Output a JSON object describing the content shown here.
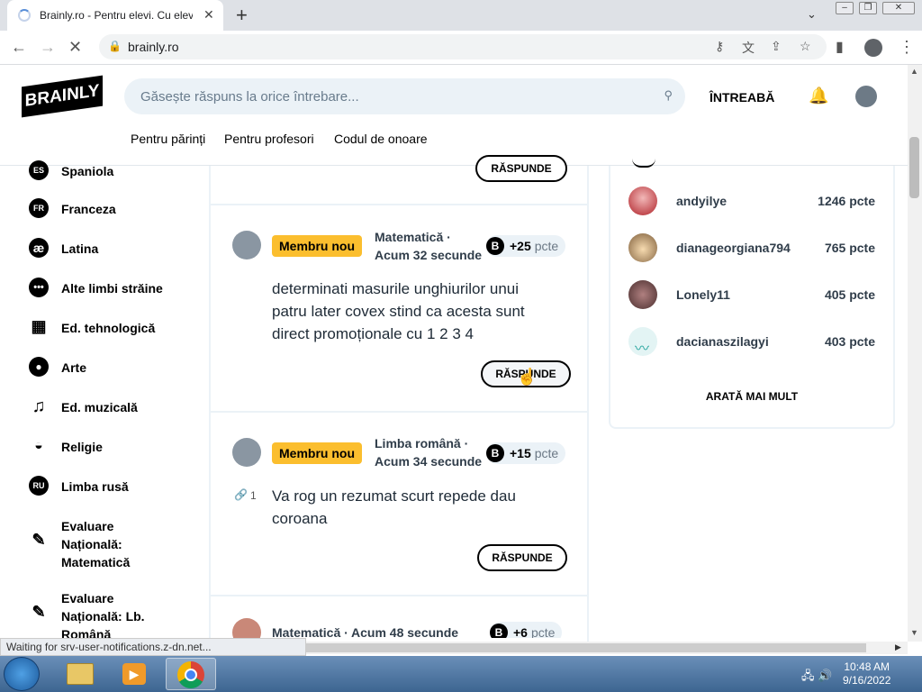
{
  "browser": {
    "tab_title": "Brainly.ro - Pentru elevi. Cu elevi.",
    "tab_close": "✕",
    "new_tab": "+",
    "url": "brainly.ro",
    "status_text": "Waiting for srv-user-notifications.z-dn.net..."
  },
  "header": {
    "logo": "BRAINLY",
    "search_placeholder": "Găsește răspuns la orice întrebare...",
    "ask_button": "ÎNTREABĂ",
    "links": [
      "Pentru părinți",
      "Pentru profesori",
      "Codul de onoare"
    ]
  },
  "sidebar": {
    "items": [
      {
        "label": "Spaniola",
        "icon": "ES"
      },
      {
        "label": "Franceza",
        "icon": "FR"
      },
      {
        "label": "Latina",
        "icon": "æ"
      },
      {
        "label": "Alte limbi străine",
        "icon": "..."
      },
      {
        "label": "Ed. tehnologică",
        "icon": "chip-icon"
      },
      {
        "label": "Arte",
        "icon": "palette-icon"
      },
      {
        "label": "Ed. muzicală",
        "icon": "music-note-icon"
      },
      {
        "label": "Religie",
        "icon": "candle-icon"
      },
      {
        "label": "Limba rusă",
        "icon": "RU"
      },
      {
        "label": "Evaluare Națională: Matematică",
        "icon": "pencil-icon"
      },
      {
        "label": "Evaluare Națională: Lb. Română",
        "icon": "pencil-icon"
      }
    ]
  },
  "feed": {
    "answer_label": "RĂSPUNDE",
    "points_unit": "pcte",
    "questions": [
      {
        "badge": "Membru nou",
        "subject": "Matematică ·",
        "time": "Acum 32 secunde",
        "points": "+25",
        "text": "determinati masurile unghiurilor unui patru later covex stind ca acesta sunt direct promoționale cu 1 2 3 4"
      },
      {
        "badge": "Membru nou",
        "subject": "Limba română ·",
        "time": "Acum 34 secunde",
        "points": "+15",
        "attachments": "1",
        "text": "Va rog un rezumat scurt repede dau coroana"
      },
      {
        "subject": "Matematică ·",
        "time": "Acum 48 secunde",
        "points": "+6"
      }
    ]
  },
  "leaderboard": {
    "users": [
      {
        "name": "andyilye",
        "points": "1246 pcte"
      },
      {
        "name": "dianageorgiana794",
        "points": "765 pcte"
      },
      {
        "name": "Lonely11",
        "points": "405 pcte"
      },
      {
        "name": "dacianaszilagyi",
        "points": "403 pcte"
      }
    ],
    "show_more": "ARATĂ MAI MULT"
  },
  "taskbar": {
    "time": "10:48 AM",
    "date": "9/16/2022"
  },
  "colors": {
    "badge_yellow": "#fbbe2e",
    "search_bg": "#ebf2f7",
    "taskbar_blue": "#3d6591"
  }
}
